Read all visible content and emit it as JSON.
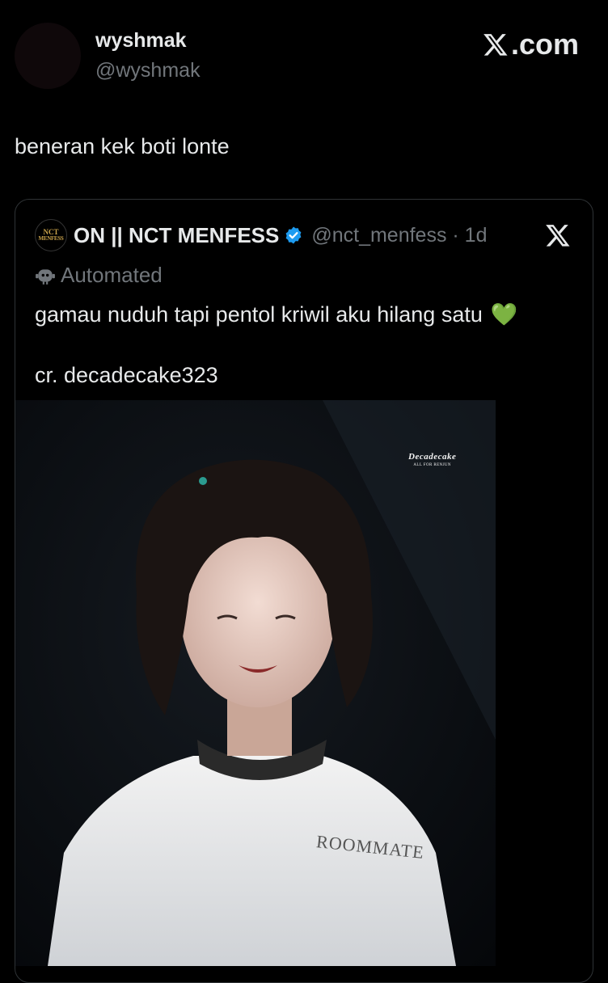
{
  "header": {
    "display_name": "wyshmak",
    "handle": "@wyshmak",
    "brand": ".com"
  },
  "tweet": {
    "text": "beneran kek boti lonte"
  },
  "quoted_tweet": {
    "avatar_text_line1": "NCT",
    "avatar_text_line2": "MENFESS",
    "name": "ON || NCT MENFESS",
    "handle_time": "@nct_menfess · 1d",
    "automated_label": "Automated",
    "text": "gamau nuduh tapi pentol kriwil aku hilang satu",
    "emoji": "💚",
    "credit": "cr. decadecake323",
    "image": {
      "watermark_title": "Decadecake",
      "watermark_subtitle": "ALL FOR RENJUN",
      "shirt_text": "ROOMMATE"
    }
  },
  "colors": {
    "background": "#000000",
    "text": "#e7e9ea",
    "muted": "#71767b",
    "verified": "#1d9bf0",
    "border": "#2f3336"
  }
}
